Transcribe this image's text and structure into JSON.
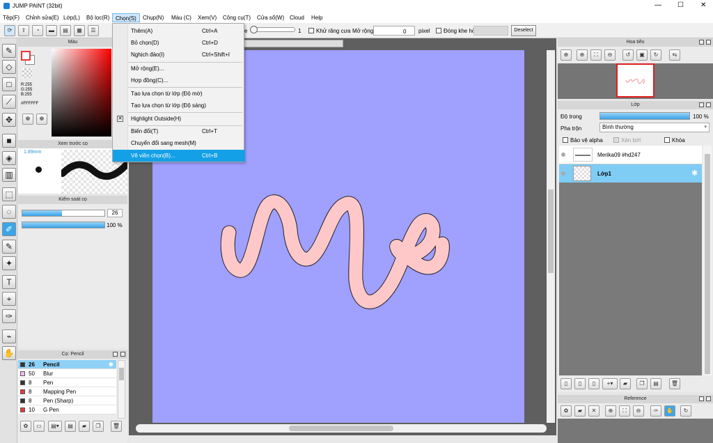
{
  "titlebar": {
    "title": "JUMP PAINT (32bit)",
    "min": "—",
    "max": "☐",
    "close": "✕"
  },
  "menubar": [
    "Tệp(F)",
    "Chỉnh sửa(E)",
    "Lớp(L)",
    "Bộ lọc(R)",
    "Chọn(S)",
    "Chụp(N)",
    "Màu (C)",
    "Xem(V)",
    "Công cụ(T)",
    "Cửa sổ(W)",
    "Cloud",
    "Help"
  ],
  "toolbar": {
    "size_value": "1",
    "antialias": "Khử răng cưa",
    "expand": "Mở rộng",
    "expand_value": "0",
    "pixel": "pixel",
    "close_gap": "Đóng khe hở",
    "deselect": "Deselect",
    "partial_label": "e"
  },
  "select_menu": {
    "items": [
      {
        "label": "Thêm(A)",
        "shortcut": "Ctrl+A"
      },
      {
        "label": "Bỏ chọn(D)",
        "shortcut": "Ctrl+D"
      },
      {
        "label": "Nghịch đảo(I)",
        "shortcut": "Ctrl+Shift+I"
      },
      {
        "label": "Mở rộng(E)...",
        "shortcut": ""
      },
      {
        "label": "Hợp đồng(C)...",
        "shortcut": ""
      },
      {
        "label": "Tạo lựa chọn từ lớp (Độ mờ)",
        "shortcut": ""
      },
      {
        "label": "Tạo lựa chọn từ lớp (Độ sáng)",
        "shortcut": ""
      },
      {
        "label": "Highlight Outside(H)",
        "shortcut": ""
      },
      {
        "label": "Biến đổi(T)",
        "shortcut": "Ctrl+T"
      },
      {
        "label": "Chuyển đổi sang mesh(M)",
        "shortcut": ""
      },
      {
        "label": "Vẽ viền chọn(B)...",
        "shortcut": "Ctrl+B"
      }
    ]
  },
  "color_panel": {
    "title": "Màu",
    "r": "R:255",
    "g": "G:255",
    "b": "B:255",
    "hex": "#FFFFFF"
  },
  "brush_preview": {
    "title": "Xem trước cọ",
    "size": "1.89mm"
  },
  "brush_control": {
    "title": "Kiểm soát cọ",
    "size_value": "26",
    "opacity_value": "100 %",
    "size_fill": 0.48,
    "opacity_fill": 1.0
  },
  "brush_list": {
    "title": "Cọ: Pencil",
    "items": [
      {
        "size": "26",
        "name": "Pencil",
        "color": "#333333"
      },
      {
        "size": "50",
        "name": "Blur",
        "color": "#f5b8f5"
      },
      {
        "size": "8",
        "name": "Pen",
        "color": "#333333"
      },
      {
        "size": "8",
        "name": "Mapping Pen",
        "color": "#e83a3a"
      },
      {
        "size": "8",
        "name": "Pen (Sharp)",
        "color": "#333333"
      },
      {
        "size": "10",
        "name": "G Pen",
        "color": "#e83a3a"
      }
    ]
  },
  "navigator": {
    "title": "Hoa tiêu"
  },
  "layer_panel": {
    "title": "Lớp",
    "opacity_label": "Độ trong",
    "opacity_value": "100 %",
    "blend_label": "Pha trộn",
    "blend_value": "Bình thường",
    "protect_alpha": "Bảo vệ alpha",
    "clip": "Xén bớt",
    "lock": "Khóa",
    "layers": [
      {
        "name": "Merika09  #hd247"
      },
      {
        "name": "Lớp1"
      }
    ]
  },
  "reference": {
    "title": "Reference"
  },
  "colors": {
    "canvas": "#a0a0ff",
    "accent": "#0ea5e9",
    "menu_highlight": "#14a0e6",
    "stroke": "#ffc8c8"
  }
}
